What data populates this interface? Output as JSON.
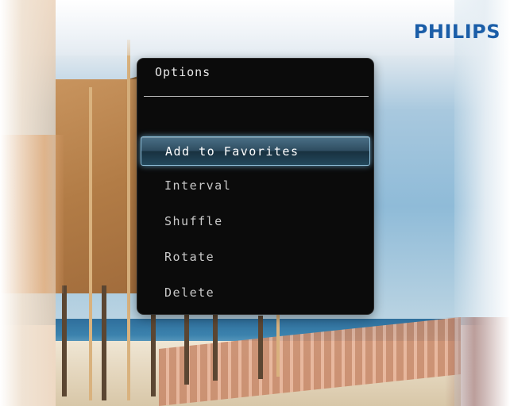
{
  "brand": {
    "logo_text": "PHILIPS",
    "color": "#1b5ea8"
  },
  "dialog": {
    "title": "Options",
    "selected_index": 0,
    "items": [
      {
        "label": "Add to Favorites"
      },
      {
        "label": "Interval"
      },
      {
        "label": "Shuffle"
      },
      {
        "label": "Rotate"
      },
      {
        "label": "Delete"
      }
    ],
    "highlight_color": "#8fc0da"
  }
}
